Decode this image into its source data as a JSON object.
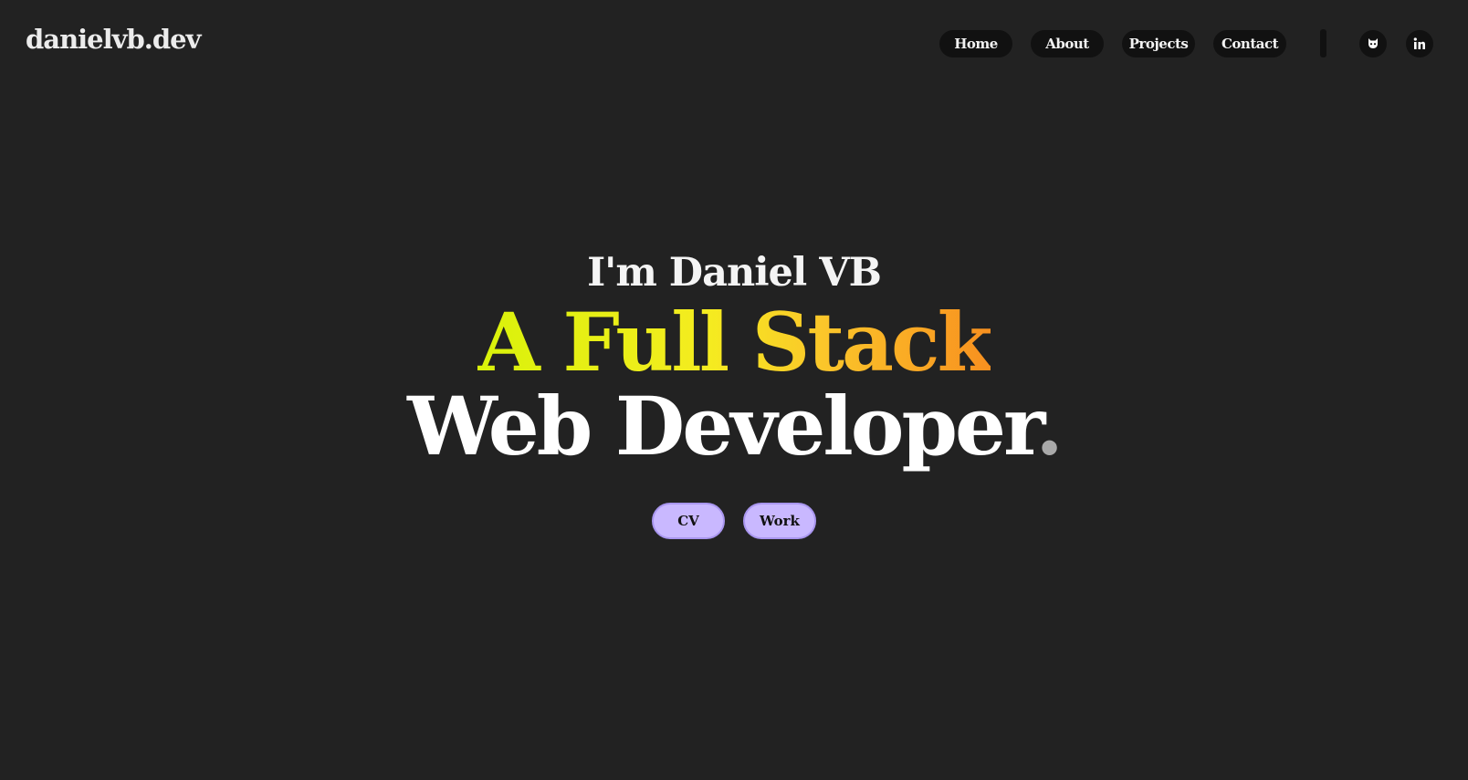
{
  "site": {
    "logo_text": "danielvb.dev"
  },
  "nav": {
    "links": [
      {
        "label": "Home"
      },
      {
        "label": "About"
      },
      {
        "label": "Projects"
      },
      {
        "label": "Contact"
      }
    ],
    "social": [
      {
        "icon": "github-icon"
      },
      {
        "icon": "linkedin-icon"
      }
    ]
  },
  "hero": {
    "intro": "I'm Daniel VB",
    "role_line1": "A Full Stack",
    "role_line2_text": "Web Developer",
    "role_line2_dot": ".",
    "buttons": [
      {
        "label": "CV"
      },
      {
        "label": "Work"
      }
    ]
  },
  "colors": {
    "background": "#222222",
    "pill_background": "#111111",
    "button_background": "#c9b8ff",
    "gradient": [
      "#d9f20a",
      "#f5ec20",
      "#fbc52a",
      "#f8901f"
    ],
    "dot": "#a9a9a9"
  }
}
